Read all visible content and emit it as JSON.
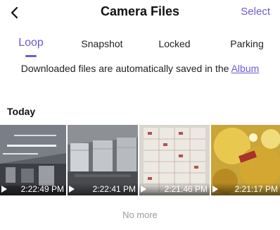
{
  "header": {
    "title": "Camera Files",
    "select_label": "Select",
    "back_icon": "chevron-left-icon"
  },
  "tabs": [
    {
      "label": "Loop",
      "active": true
    },
    {
      "label": "Snapshot",
      "active": false
    },
    {
      "label": "Locked",
      "active": false
    },
    {
      "label": "Parking",
      "active": false
    }
  ],
  "notice": {
    "text_before": "Downloaded files are automatically saved in the",
    "link_text": "Album"
  },
  "sections": [
    {
      "title": "Today",
      "items": [
        {
          "time": "2:22:49 PM",
          "type": "video"
        },
        {
          "time": "2:22:41 PM",
          "type": "video"
        },
        {
          "time": "2:21:46 PM",
          "type": "video"
        },
        {
          "time": "2:21:17 PM",
          "type": "video"
        }
      ]
    }
  ],
  "footer": {
    "text": "No more"
  },
  "colors": {
    "accent": "#6a5bd6",
    "muted": "#9a9a9a"
  }
}
